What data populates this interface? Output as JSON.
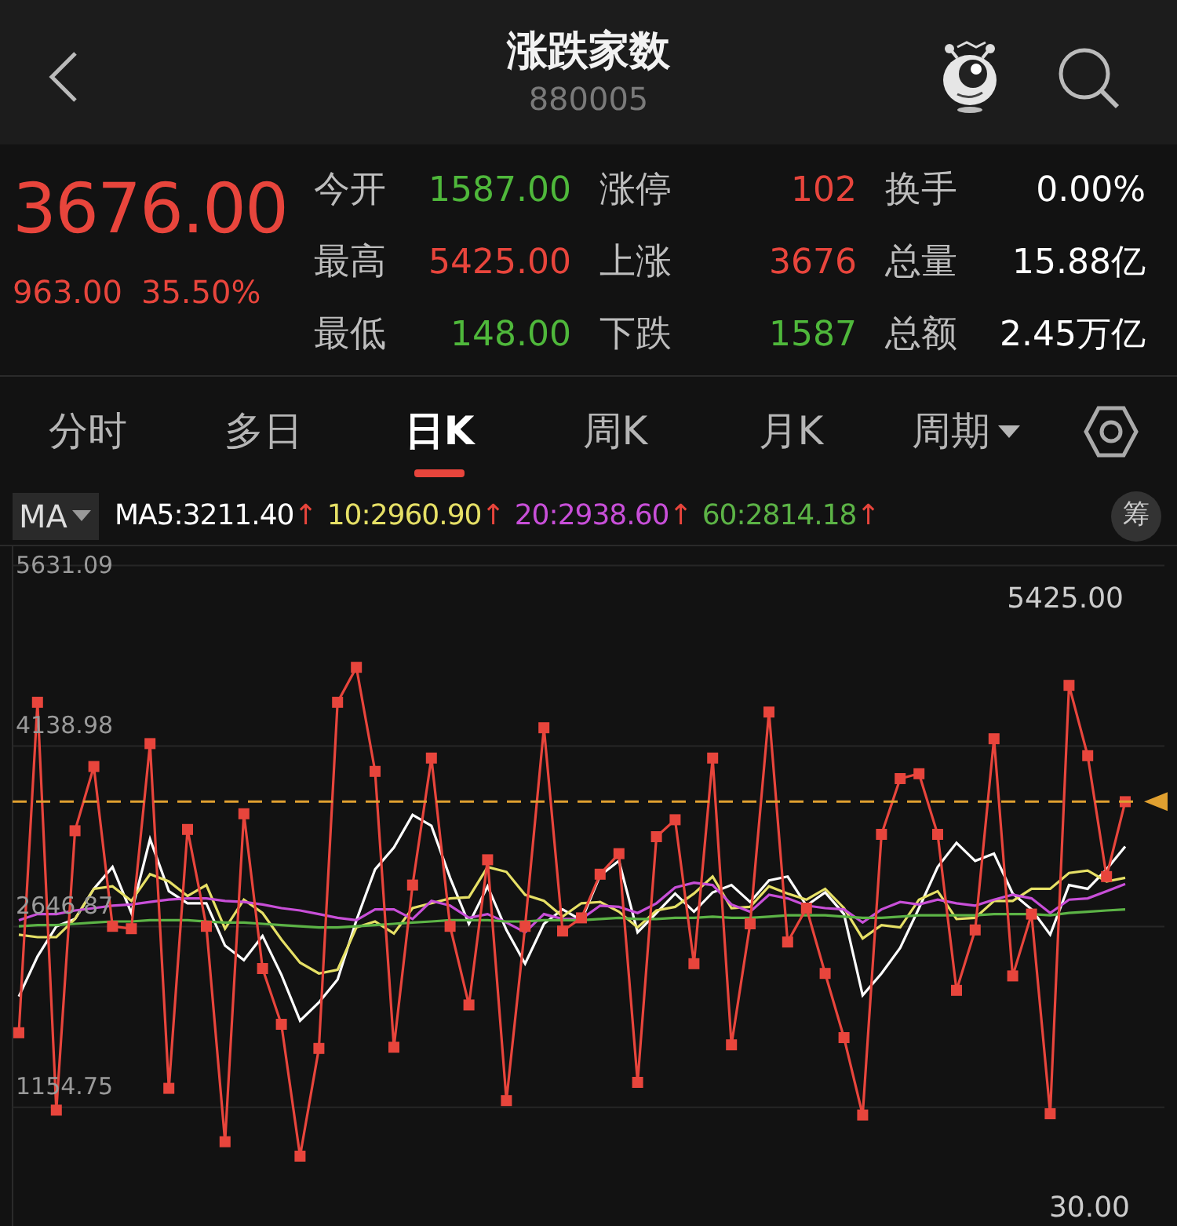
{
  "header": {
    "title": "涨跌家数",
    "code": "880005"
  },
  "quote": {
    "price": "3676.00",
    "change": "963.00",
    "change_pct": "35.50%",
    "stats": [
      {
        "label": "今开",
        "value": "1587.00",
        "color": "#4fb83b"
      },
      {
        "label": "涨停",
        "value": "102",
        "color": "#e8453c"
      },
      {
        "label": "换手",
        "value": "0.00%",
        "color": "#ffffff"
      },
      {
        "label": "最高",
        "value": "5425.00",
        "color": "#e8453c"
      },
      {
        "label": "上涨",
        "value": "3676",
        "color": "#e8453c"
      },
      {
        "label": "总量",
        "value": "15.88亿",
        "color": "#ffffff"
      },
      {
        "label": "最低",
        "value": "148.00",
        "color": "#4fb83b"
      },
      {
        "label": "下跌",
        "value": "1587",
        "color": "#4fb83b"
      },
      {
        "label": "总额",
        "value": "2.45万亿",
        "color": "#ffffff"
      }
    ]
  },
  "tabs": [
    {
      "label": "分时",
      "selected": false,
      "kind": "plain"
    },
    {
      "label": "多日",
      "selected": false,
      "kind": "plain"
    },
    {
      "label": "日K",
      "selected": true,
      "kind": "plain"
    },
    {
      "label": "周K",
      "selected": false,
      "kind": "plain"
    },
    {
      "label": "月K",
      "selected": false,
      "kind": "plain"
    },
    {
      "label": "周期",
      "selected": false,
      "kind": "dropdown"
    }
  ],
  "indicator": {
    "name": "MA",
    "chip": "筹",
    "lines": [
      {
        "label": "MA5:",
        "value": "3211.40",
        "arrow": "↑",
        "color": "#ffffff"
      },
      {
        "label": "10:",
        "value": "2960.90",
        "arrow": "↑",
        "color": "#e6e066"
      },
      {
        "label": "20:",
        "value": "2938.60",
        "arrow": "↑",
        "color": "#c84fd8"
      },
      {
        "label": "60:",
        "value": "2814.18",
        "arrow": "↑",
        "color": "#5cb346"
      }
    ]
  },
  "chart": {
    "high_label": "5425.00",
    "low_label": "30.00",
    "chart_data": {
      "type": "line",
      "ylim": [
        147,
        5790
      ],
      "grid": true,
      "ref_lines": [
        {
          "axis": "y",
          "value": 3680,
          "color": "#e0a030"
        }
      ],
      "yticks": [
        {
          "value": 5631.09,
          "label": "5631.09"
        },
        {
          "value": 4138.98,
          "label": "4138.98"
        },
        {
          "value": 2646.87,
          "label": "2646.87"
        },
        {
          "value": 1154.75,
          "label": "1154.75"
        }
      ],
      "series": [
        {
          "color": "#e8453c",
          "marker": true,
          "values": [
            1770,
            4500,
            1130,
            3440,
            3970,
            2650,
            2630,
            4160,
            1310,
            3450,
            2650,
            870,
            3580,
            2300,
            1840,
            750,
            1640,
            4500,
            4790,
            3930,
            1650,
            2990,
            4040,
            2650,
            2000,
            3200,
            1210,
            2650,
            4290,
            2610,
            2720,
            3080,
            3250,
            1360,
            3390,
            3530,
            2340,
            4040,
            1670,
            2670,
            4420,
            2520,
            2800,
            2260,
            1730,
            1090,
            3410,
            3870,
            3910,
            3410,
            2120,
            2620,
            4200,
            2240,
            2750,
            1100,
            4640,
            4060,
            3060,
            3680
          ]
        },
        {
          "color": "#5cb346",
          "values": [
            2650,
            2660,
            2660,
            2670,
            2680,
            2690,
            2690,
            2700,
            2700,
            2700,
            2690,
            2680,
            2680,
            2670,
            2660,
            2650,
            2640,
            2640,
            2650,
            2660,
            2670,
            2680,
            2690,
            2700,
            2700,
            2700,
            2690,
            2690,
            2700,
            2700,
            2700,
            2710,
            2720,
            2710,
            2710,
            2720,
            2720,
            2730,
            2720,
            2720,
            2730,
            2740,
            2740,
            2740,
            2730,
            2720,
            2720,
            2730,
            2740,
            2740,
            2740,
            2740,
            2750,
            2750,
            2750,
            2740,
            2760,
            2770,
            2780,
            2790
          ]
        },
        {
          "color": "#c84fd8",
          "values": [
            2700,
            2750,
            2750,
            2780,
            2800,
            2820,
            2830,
            2850,
            2870,
            2880,
            2880,
            2860,
            2850,
            2830,
            2800,
            2780,
            2750,
            2720,
            2700,
            2790,
            2790,
            2710,
            2860,
            2820,
            2720,
            2750,
            2680,
            2600,
            2750,
            2710,
            2710,
            2820,
            2810,
            2760,
            2840,
            2970,
            3010,
            2990,
            2830,
            2770,
            2910,
            2880,
            2820,
            2800,
            2790,
            2680,
            2790,
            2850,
            2830,
            2870,
            2840,
            2820,
            2870,
            2910,
            2880,
            2760,
            2870,
            2880,
            2940,
            3000
          ]
        },
        {
          "color": "#e6e066",
          "values": [
            2580,
            2560,
            2560,
            2710,
            2960,
            2980,
            2860,
            3080,
            3020,
            2900,
            2990,
            2630,
            2870,
            2760,
            2540,
            2350,
            2260,
            2290,
            2640,
            2690,
            2590,
            2800,
            2840,
            2880,
            2890,
            3140,
            3100,
            2910,
            2860,
            2730,
            2840,
            2850,
            2770,
            2640,
            2780,
            2810,
            2920,
            3060,
            2800,
            2810,
            2980,
            2920,
            2870,
            2960,
            2800,
            2550,
            2660,
            2640,
            2870,
            2940,
            2710,
            2720,
            2860,
            2860,
            2960,
            2960,
            3090,
            3110,
            3020,
            3050
          ]
        },
        {
          "color": "#ffffff",
          "values": [
            2070,
            2400,
            2650,
            2710,
            2960,
            3140,
            2760,
            3370,
            2940,
            2840,
            2840,
            2490,
            2370,
            2570,
            2250,
            1870,
            2020,
            2210,
            2700,
            3120,
            3300,
            3570,
            3480,
            3050,
            2670,
            2980,
            2620,
            2340,
            2670,
            2790,
            2700,
            3070,
            3190,
            2600,
            2760,
            2920,
            2770,
            2930,
            2990,
            2850,
            3030,
            3060,
            2820,
            2930,
            2750,
            2080,
            2260,
            2470,
            2800,
            3140,
            3340,
            3190,
            3250,
            2920,
            2790,
            2580,
            2990,
            2960,
            3120,
            3310
          ]
        }
      ]
    }
  }
}
